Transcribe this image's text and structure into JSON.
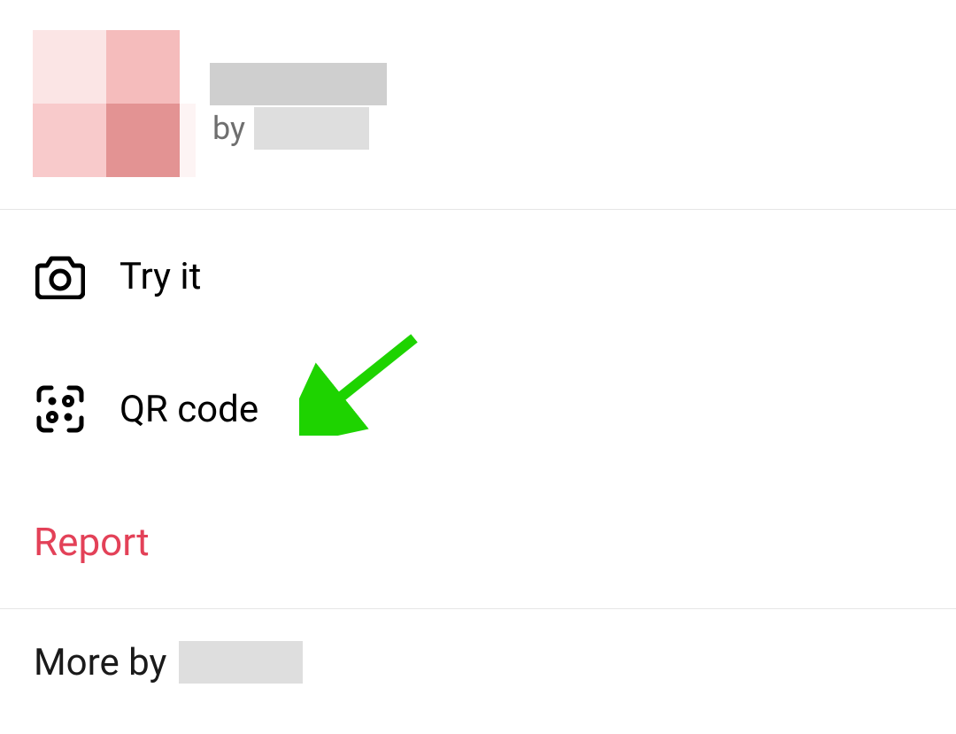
{
  "header": {
    "by_label": "by",
    "avatar_colors": [
      "#fbe5e5",
      "#f5bcbc",
      "#f8cacb",
      "#e39393"
    ]
  },
  "actions": {
    "try_it": {
      "label": "Try it"
    },
    "qr_code": {
      "label": "QR code"
    },
    "report": {
      "label": "Report"
    }
  },
  "more_by": {
    "prefix": "More by"
  },
  "annotation": {
    "arrow_color": "#1ED300"
  }
}
